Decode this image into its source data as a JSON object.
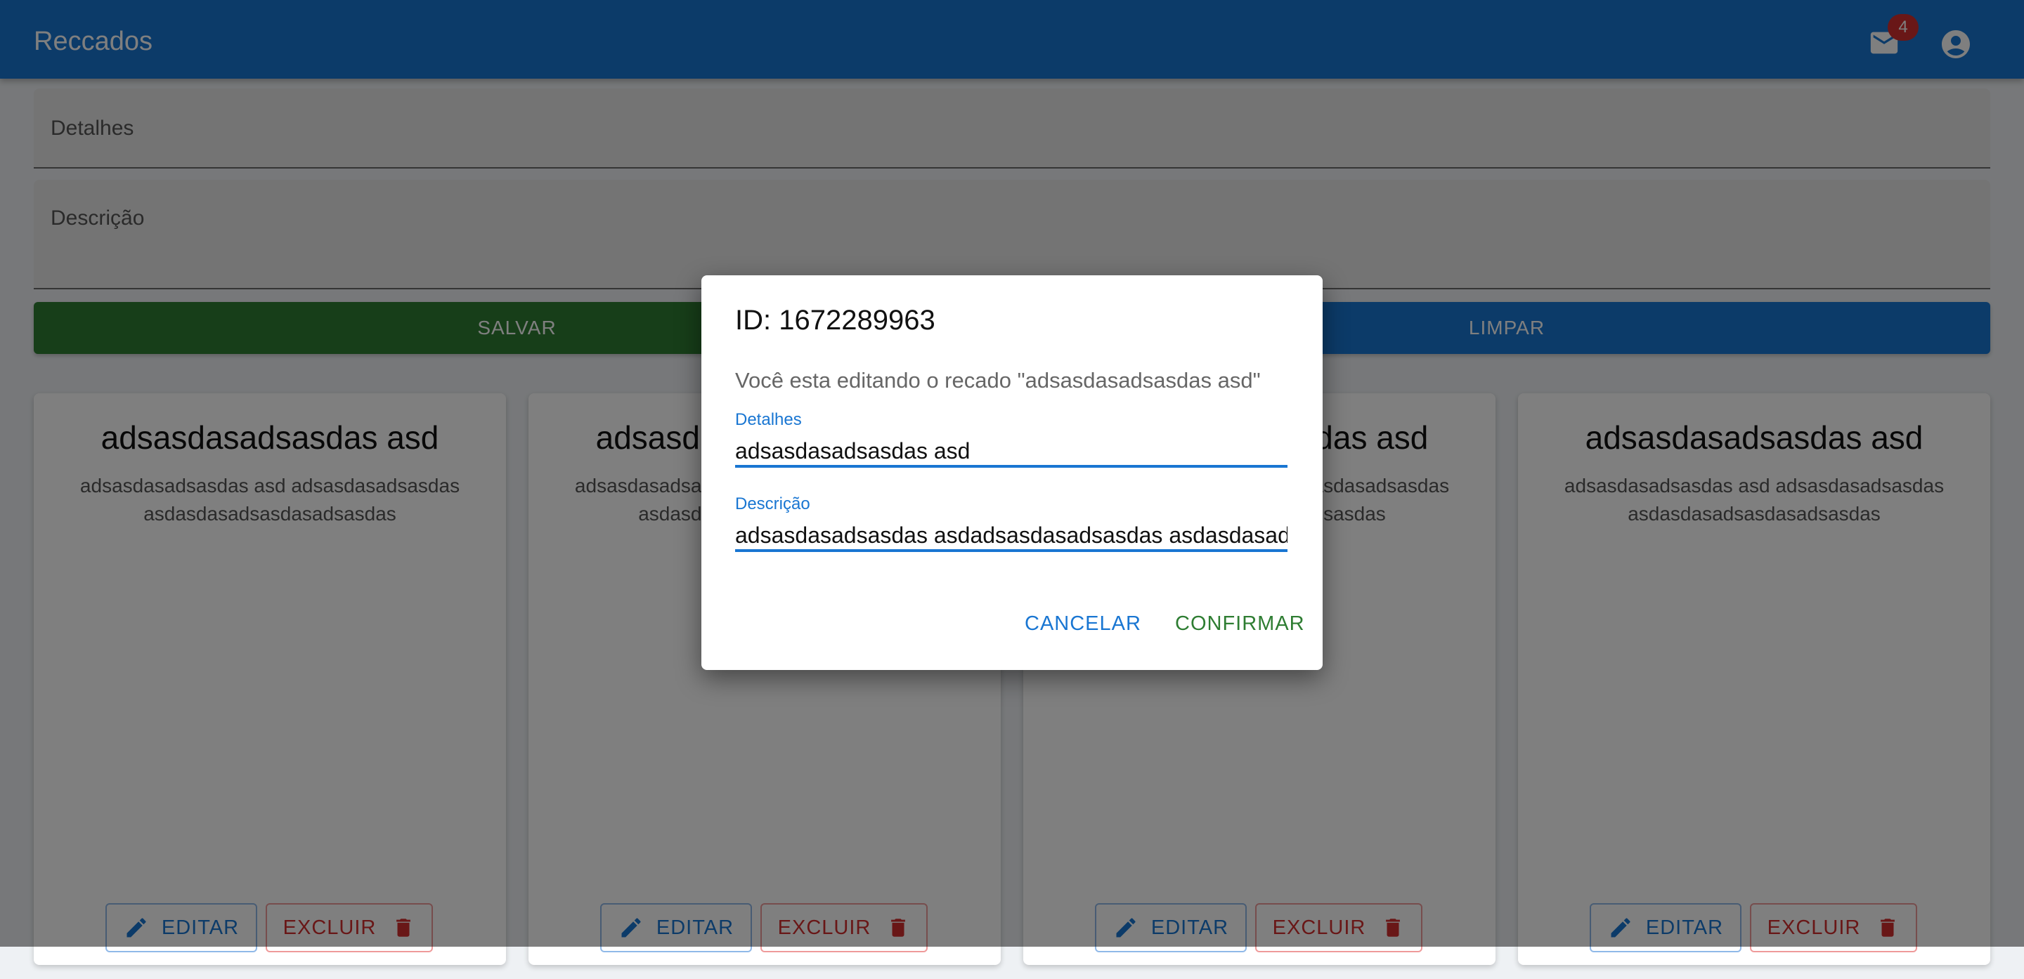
{
  "app": {
    "title": "Reccados",
    "badge_count": "4"
  },
  "form": {
    "detalhes_label": "Detalhes",
    "descricao_label": "Descrição",
    "save_label": "SALVAR",
    "clear_label": "LIMPAR"
  },
  "cards": [
    {
      "title": "adsasdasadsasdas asd",
      "description": "adsasdasadsasdas asd adsasdasadsasdas asdasdasadsasdasadsasdas",
      "edit_label": "EDITAR",
      "delete_label": "EXCLUIR"
    },
    {
      "title": "adsasdasadsasdas asd",
      "description": "adsasdasadsasdas asd adsasdasadsasdas asdasdasadsasdasadsasdas",
      "edit_label": "EDITAR",
      "delete_label": "EXCLUIR"
    },
    {
      "title": "adsasdasadsasdas asd",
      "description": "adsasdasadsasdas asd adsasdasadsasdas asdasdasadsasdasadsasdas",
      "edit_label": "EDITAR",
      "delete_label": "EXCLUIR"
    },
    {
      "title": "adsasdasadsasdas asd",
      "description": "adsasdasadsasdas asd adsasdasadsasdas asdasdasadsasdasadsasdas",
      "edit_label": "EDITAR",
      "delete_label": "EXCLUIR"
    }
  ],
  "dialog": {
    "title": "ID: 1672289963",
    "text": "Você esta editando o recado \"adsasdasadsasdas asd\"",
    "detalhes_label": "Detalhes",
    "detalhes_value": "adsasdasadsasdas asd",
    "descricao_label": "Descrição",
    "descricao_value": "adsasdasadsasdas asdadsasdasadsasdas asdasdasadsasdasadsasdas",
    "cancel_label": "CANCELAR",
    "confirm_label": "CONFIRMAR"
  },
  "colors": {
    "primary": "#1976d2",
    "success": "#2e7d32",
    "error": "#d32f2f"
  },
  "icons": [
    "mail-icon",
    "account-circle-icon",
    "pencil-icon",
    "trash-icon"
  ]
}
